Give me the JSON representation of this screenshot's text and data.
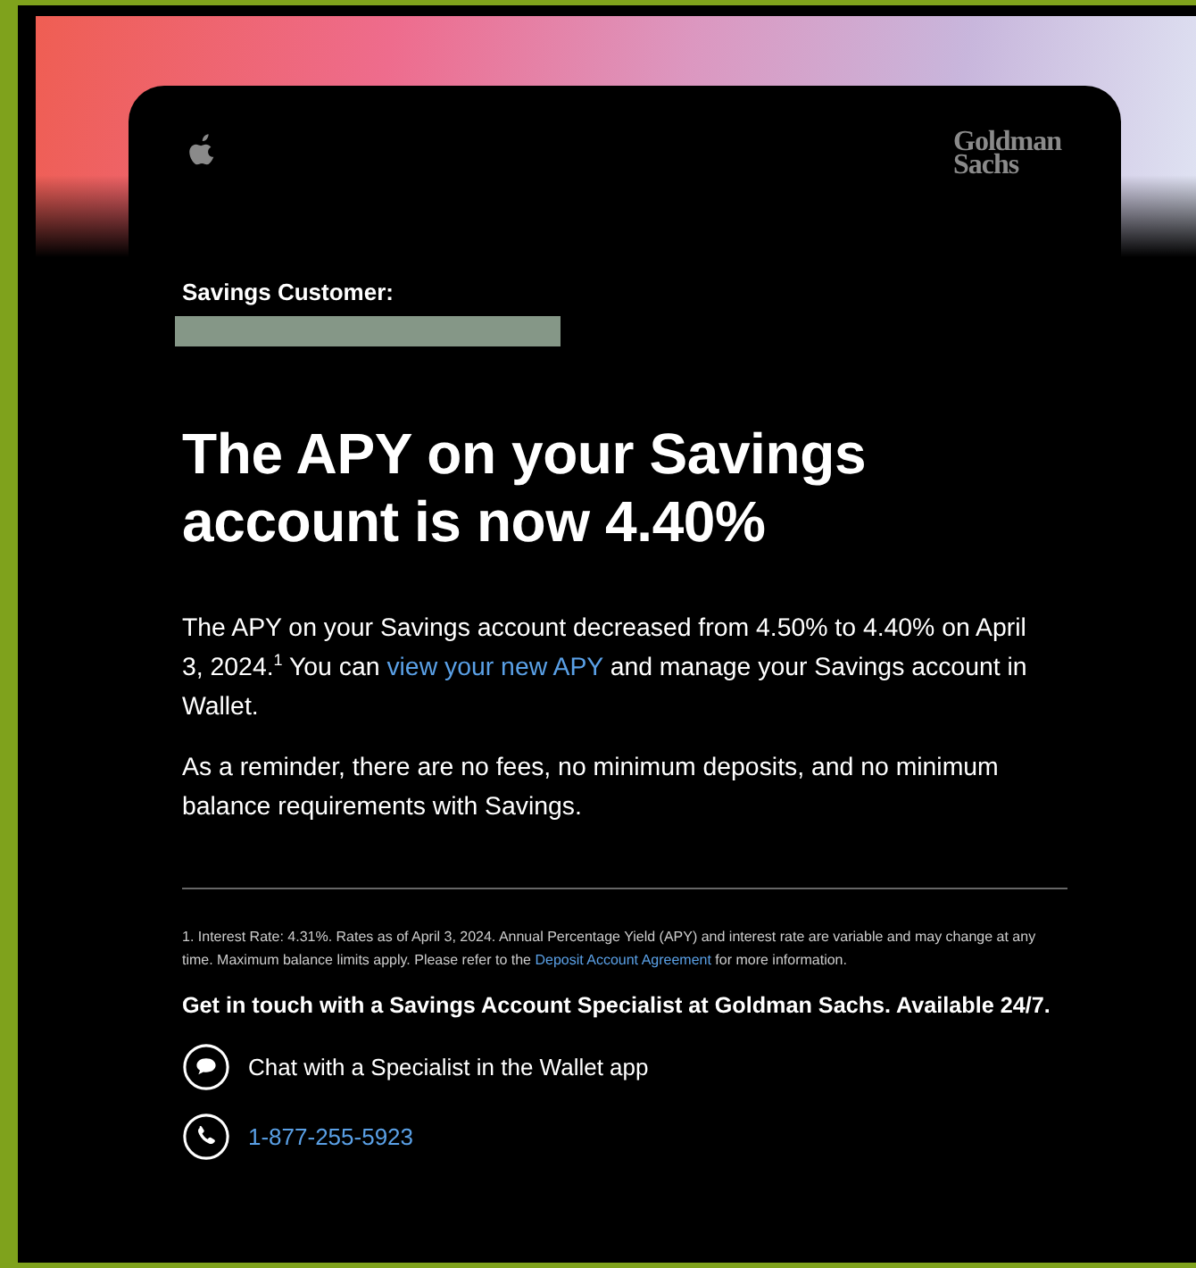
{
  "header": {
    "logo_text": "Goldman Sachs"
  },
  "greeting": {
    "label": "Savings Customer:"
  },
  "headline": "The APY on your Savings account is now 4.40%",
  "paragraphs": [
    [
      {
        "kind": "text",
        "text": "The APY on your Savings account decreased from 4.50% to 4.40% on April 3, 2024.$^{1}$ You can "
      },
      {
        "kind": "link",
        "text": "view your new APY"
      },
      {
        "kind": "text",
        "text": " and manage your Savings account in Wallet."
      }
    ],
    [
      {
        "kind": "text",
        "text": "As a reminder, there are no fees, no minimum deposits, and no minimum balance requirements with Savings."
      }
    ]
  ],
  "footnote": [
    {
      "kind": "text",
      "text": "1. Interest Rate: 4.31%. Rates as of April 3, 2024. Annual Percentage Yield (APY) and interest rate are variable and may change at any time. Maximum balance limits apply. Please refer to the "
    },
    {
      "kind": "link",
      "text": "Deposit Account Agreement"
    },
    {
      "kind": "text",
      "text": " for more information."
    }
  ],
  "contact": {
    "heading": "Get in touch with a Savings Account Specialist at Goldman Sachs. Available 24/7.",
    "items": [
      {
        "kind": "chat",
        "text": "Chat with a Specialist in the Wallet app"
      },
      {
        "kind": "phone",
        "text": "1-877-255-5923"
      }
    ]
  }
}
